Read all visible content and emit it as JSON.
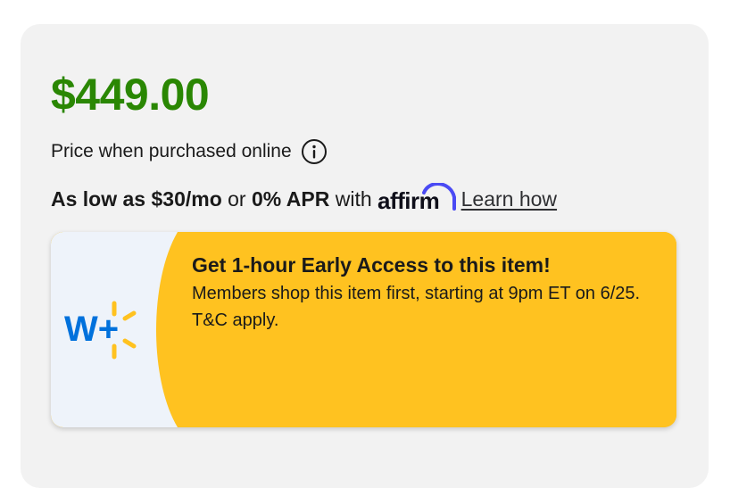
{
  "pricing": {
    "price": "$449.00",
    "price_note": "Price when purchased online",
    "info_icon": "info-circle-icon"
  },
  "financing": {
    "as_low_as": "As low as $30/mo",
    "or": "or",
    "apr": "0% APR",
    "with": "with",
    "provider_logo": "affirm",
    "learn_link": "Learn how"
  },
  "promo": {
    "logo_icon": "walmart-plus-icon",
    "title": "Get 1-hour Early Access to this item!",
    "body": "Members shop this item first, starting at 9pm ET on 6/25. T&C apply."
  },
  "colors": {
    "price_green": "#2a8703",
    "promo_yellow": "#ffc220",
    "promo_left_bg": "#eef3fa",
    "walmart_blue": "#0071dc",
    "affirm_purple": "#4a4af4"
  }
}
